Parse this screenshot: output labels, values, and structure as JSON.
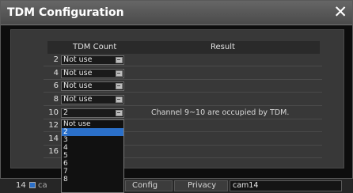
{
  "window": {
    "title": "TDM Configuration",
    "close_icon": "✕"
  },
  "table": {
    "headers": {
      "count": "TDM Count",
      "result": "Result"
    },
    "rows": [
      {
        "num": "2",
        "value": "Not use",
        "result": ""
      },
      {
        "num": "4",
        "value": "Not use",
        "result": ""
      },
      {
        "num": "6",
        "value": "Not use",
        "result": ""
      },
      {
        "num": "8",
        "value": "Not use",
        "result": ""
      },
      {
        "num": "10",
        "value": "2",
        "result": "Channel 9~10 are occupied by TDM."
      },
      {
        "num": "12",
        "value": "",
        "result": ""
      },
      {
        "num": "14",
        "value": "",
        "result": ""
      },
      {
        "num": "16",
        "value": "",
        "result": ""
      }
    ]
  },
  "dropdown": {
    "options": [
      "Not use",
      "2",
      "3",
      "4",
      "5",
      "6",
      "7",
      "8"
    ],
    "selected": "2"
  },
  "bottom": {
    "cam_number": "14",
    "cam_label_partial": "ca",
    "config_label": "Config",
    "privacy_label": "Privacy",
    "cam_name": "cam14"
  }
}
